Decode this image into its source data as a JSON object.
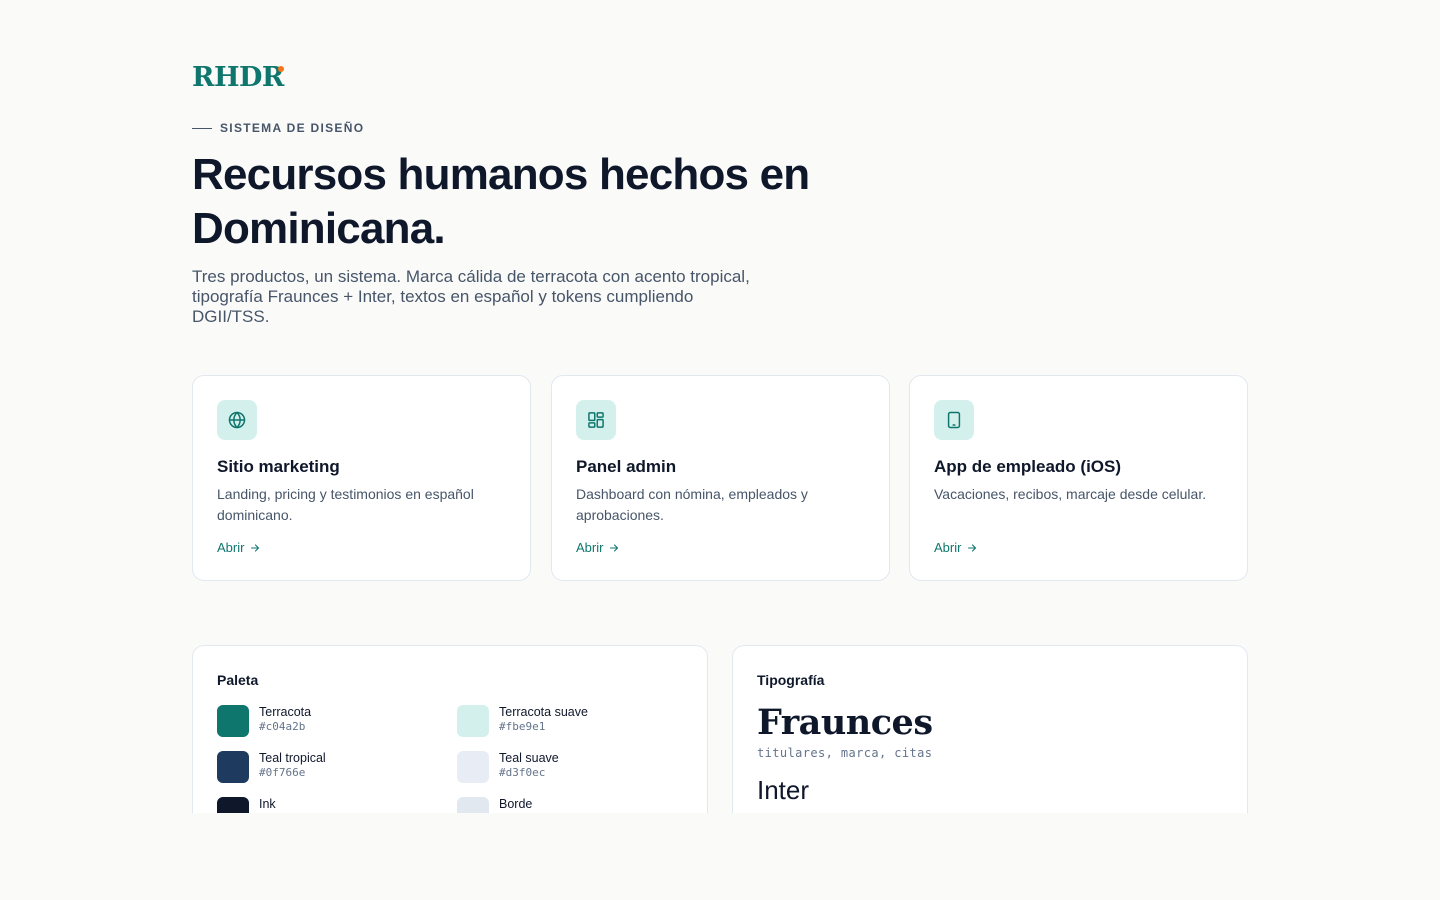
{
  "brand": {
    "logo": "RHDR",
    "accent_dot_color": "#f97316"
  },
  "hero": {
    "eyebrow": "SISTEMA DE DISEÑO",
    "title": "Recursos humanos hechos en Dominicana.",
    "subtitle": "Tres productos, un sistema. Marca cálida de terracota con acento tropical, tipografía Fraunces + Inter, textos en español y tokens cumpliendo DGII/TSS."
  },
  "products": [
    {
      "icon": "globe-icon",
      "title": "Sitio marketing",
      "description": "Landing, pricing y testimonios en español dominicano.",
      "link": "Abrir"
    },
    {
      "icon": "dashboard-grid-icon",
      "title": "Panel admin",
      "description": "Dashboard con nómina, empleados y aprobaciones.",
      "link": "Abrir"
    },
    {
      "icon": "tablet-icon",
      "title": "App de empleado (iOS)",
      "description": "Vacaciones, recibos, marcaje desde celular.",
      "link": "Abrir"
    }
  ],
  "palette": {
    "title": "Paleta",
    "swatches": [
      {
        "name": "Terracota",
        "hex": "#c04a2b",
        "color": "#0f766e"
      },
      {
        "name": "Terracota suave",
        "hex": "#fbe9e1",
        "color": "#d3f0ec"
      },
      {
        "name": "Teal tropical",
        "hex": "#0f766e",
        "color": "#1e3a5f"
      },
      {
        "name": "Teal suave",
        "hex": "#d3f0ec",
        "color": "#e8edf5"
      },
      {
        "name": "Ink",
        "hex": "",
        "color": "#0f172a"
      },
      {
        "name": "Borde",
        "hex": "",
        "color": "#e2e8f0"
      }
    ]
  },
  "typography": {
    "title": "Tipografía",
    "serif_name": "Fraunces",
    "serif_use": "titulares, marca, citas",
    "sans_name": "Inter",
    "sans_use": ""
  },
  "colors": {
    "accent": "#0f766e",
    "icon_bg": "#d3f0ec",
    "text": "#0f172a",
    "muted": "#475569"
  }
}
